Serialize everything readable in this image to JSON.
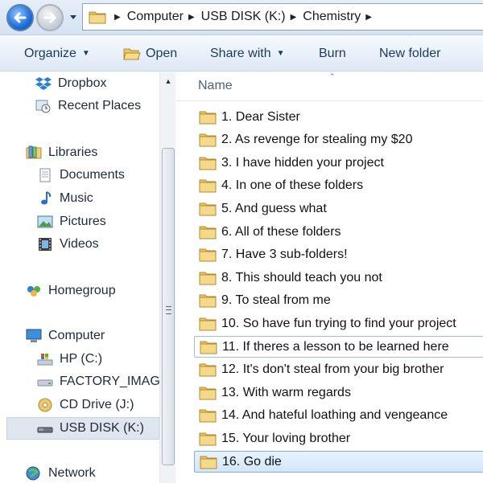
{
  "address": {
    "crumbs": [
      "Computer",
      "USB DISK (K:)",
      "Chemistry"
    ]
  },
  "toolbar": {
    "organize": "Organize",
    "open": "Open",
    "share_with": "Share with",
    "burn": "Burn",
    "new_folder": "New folder"
  },
  "nav": {
    "dropbox": "Dropbox",
    "recent_places": "Recent Places",
    "libraries": "Libraries",
    "documents": "Documents",
    "music": "Music",
    "pictures": "Pictures",
    "videos": "Videos",
    "homegroup": "Homegroup",
    "computer": "Computer",
    "hp": "HP (C:)",
    "factory": "FACTORY_IMAGE",
    "cd_drive": "CD Drive (J:)",
    "usb_disk": "USB DISK (K:)",
    "network": "Network"
  },
  "columns": {
    "name": "Name"
  },
  "files": [
    "1. Dear Sister",
    "2. As revenge for stealing my $20",
    "3. I have hidden your project",
    "4. In one of these folders",
    "5. And guess what",
    "6. All of these folders",
    "7. Have 3 sub-folders!",
    "8. This should teach you not",
    "9. To steal from me",
    "10. So have fun trying to find your project",
    "11. If theres a lesson to be learned here",
    "12. It's don't steal from your big brother",
    "13. With warm regards",
    "14. And hateful loathing and vengeance",
    "15. Your loving brother",
    "16. Go die"
  ],
  "colors": {
    "accent": "#1e6fd6",
    "selection": "#d3e6fb",
    "folder": "#e8c56a"
  }
}
